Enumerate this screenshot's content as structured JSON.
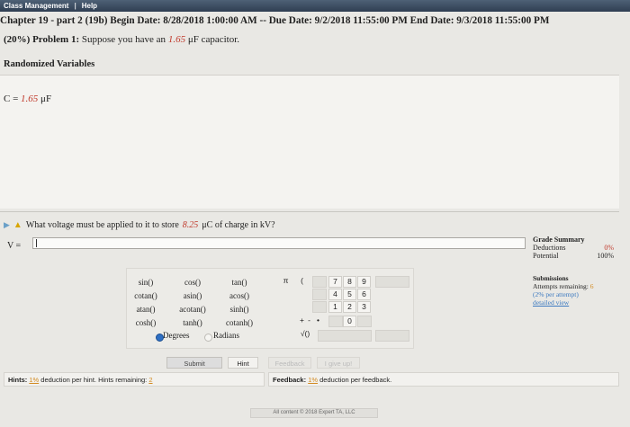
{
  "menu": {
    "class_management": "Class Management",
    "separator": "|",
    "help": "Help"
  },
  "header": {
    "text": "Chapter 19 - part 2 (19b) Begin Date: 8/28/2018 1:00:00 AM -- Due Date: 9/2/2018 11:55:00 PM End Date: 9/3/2018 11:55:00 PM"
  },
  "problem": {
    "weight": "(20%)",
    "label": "Problem 1:",
    "text_before": "Suppose you have an",
    "value": "1.65",
    "unit": "μF capacitor."
  },
  "randomized": {
    "title": "Randomized Variables",
    "var": "C = ",
    "value": "1.65",
    "unit": " μF"
  },
  "question": {
    "text_before": "What voltage must be applied to it to store",
    "value": "8.25",
    "text_after": "μC of charge in kV?"
  },
  "answer": {
    "label": "V =",
    "value": ""
  },
  "keypad": {
    "functions": [
      [
        "sin()",
        "cos()",
        "tan()"
      ],
      [
        "cotan()",
        "asin()",
        "acos()"
      ],
      [
        "atan()",
        "acotan()",
        "sinh()"
      ],
      [
        "cosh()",
        "tanh()",
        "cotanh()"
      ]
    ],
    "pi": "π",
    "open_paren": "(",
    "digits": [
      [
        "7",
        "8",
        "9"
      ],
      [
        "4",
        "5",
        "6"
      ],
      [
        "1",
        "2",
        "3"
      ]
    ],
    "zero": "0",
    "dot": "•",
    "plus": "+",
    "minus": "-",
    "sqrt": "√()",
    "degrees": "Degrees",
    "radians": "Radians"
  },
  "buttons": {
    "submit": "Submit",
    "hint": "Hint",
    "feedback": "Feedback",
    "give_up": "I give up!"
  },
  "hints": {
    "label": "Hints:",
    "percent": "1%",
    "text": "deduction per hint. Hints remaining:",
    "remaining": "2"
  },
  "feedback": {
    "label": "Feedback:",
    "percent": "1%",
    "text": "deduction per feedback."
  },
  "footer": {
    "text": "All content © 2018 Expert TA, LLC"
  },
  "grade_summary": {
    "title": "Grade Summary",
    "deductions_label": "Deductions",
    "deductions_value": "0%",
    "potential_label": "Potential",
    "potential_value": "100%"
  },
  "submissions": {
    "title": "Submissions",
    "attempts_label": "Attempts remaining:",
    "attempts_value": "6",
    "per_attempt": "(2% per attempt)",
    "detailed_view": "detailed view"
  },
  "colors": {
    "highlight_red": "#c0392b",
    "link_blue": "#3d7ac0",
    "radio_blue": "#2e6fc4",
    "orange": "#d28b23"
  }
}
